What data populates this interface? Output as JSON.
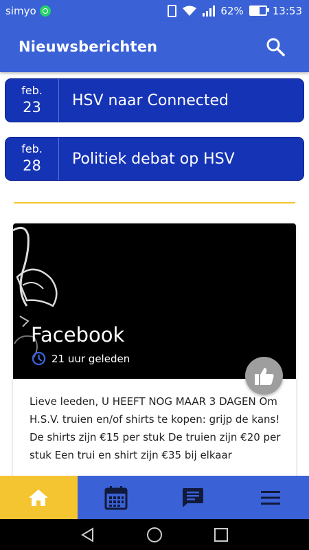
{
  "status_bar": {
    "carrier": "simyo",
    "battery": "62%",
    "battery_level": 0.62,
    "time": "13:53"
  },
  "app_bar": {
    "title": "Nieuwsberichten",
    "search_icon": "search-icon"
  },
  "news": [
    {
      "month": "feb.",
      "day": "23",
      "title": "HSV naar Connected"
    },
    {
      "month": "feb.",
      "day": "28",
      "title": "Politiek debat op HSV"
    }
  ],
  "post": {
    "source": "Facebook",
    "time_ago": "21 uur geleden",
    "body": "Lieve leeden, U HEEFT NOG MAAR 3 DAGEN Om H.S.V. truien en/of shirts te kopen: grijp de kans! De shirts zijn €15 per stuk De truien zijn €20 per stuk Een trui en shirt zijn €35 bij elkaar",
    "like_icon": "thumbs-up-icon"
  },
  "bottom_nav": {
    "tabs": [
      "home-icon",
      "calendar-icon",
      "chat-icon",
      "menu-icon"
    ],
    "active": "home-icon"
  },
  "colors": {
    "primary": "#3a62d6",
    "news_item": "#1533b5",
    "accent": "#f5c431"
  }
}
